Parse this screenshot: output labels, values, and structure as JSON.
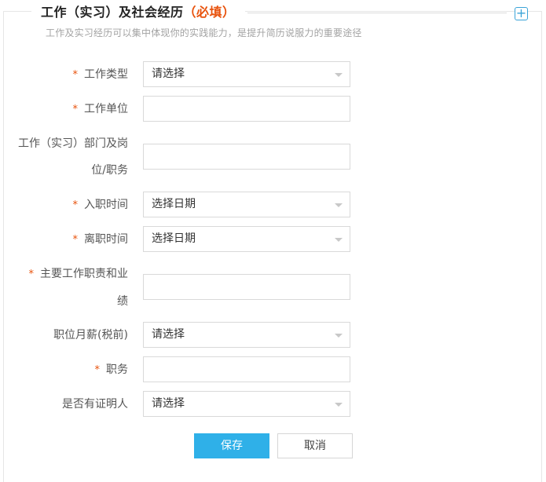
{
  "header": {
    "title": "工作（实习）及社会经历",
    "required_tag": "（必填）",
    "subtitle": "工作及实习经历可以集中体现你的实践能力，是提升简历说服力的重要途径",
    "add_icon": "plus-icon"
  },
  "form": {
    "required_mark": "*",
    "job_type": {
      "label": "工作类型",
      "value": "请选择"
    },
    "employer": {
      "label": "工作单位",
      "value": ""
    },
    "department": {
      "label_line1": "工作（实习）部门及岗",
      "label_line2": "位/职务",
      "value": ""
    },
    "start_date": {
      "label": "入职时间",
      "value": "选择日期"
    },
    "end_date": {
      "label": "离职时间",
      "value": "选择日期"
    },
    "duties": {
      "label_line1": "主要工作职责和业",
      "label_line2": "绩",
      "value": ""
    },
    "salary": {
      "label": "职位月薪(税前)",
      "value": "请选择"
    },
    "position": {
      "label": "职务",
      "value": ""
    },
    "reference": {
      "label": "是否有证明人",
      "value": "请选择"
    }
  },
  "actions": {
    "save_label": "保存",
    "cancel_label": "取消"
  },
  "colors": {
    "accent": "#2fb0e8",
    "required": "#e8520c",
    "border": "#d9d9d9"
  }
}
